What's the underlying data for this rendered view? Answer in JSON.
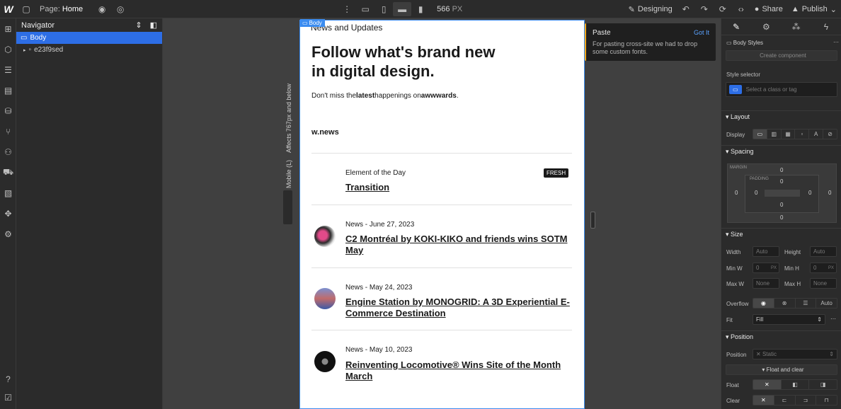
{
  "topbar": {
    "logo": "W",
    "page_prefix": "Page:",
    "page_name": "Home",
    "width_value": "566",
    "width_unit": "PX",
    "designing_label": "Designing",
    "share_label": "Share",
    "publish_label": "Publish"
  },
  "navigator": {
    "title": "Navigator",
    "items": [
      {
        "label": "Body"
      },
      {
        "label": "e23f9sed"
      }
    ]
  },
  "canvas": {
    "affects_label": "Affects 767px and below",
    "mobile_label": "Mobile (L)",
    "body_tag": "Body"
  },
  "page": {
    "kicker": "News and Updates",
    "title": "Follow what's brand new in digital design.",
    "sub_pre": "Don't miss the",
    "sub_bold1": "latest",
    "sub_mid": "happenings on",
    "sub_bold2": "awwwards",
    "sub_post": ".",
    "brand": "w.news",
    "fresh_badge": "FRESH",
    "items": [
      {
        "meta": "Element of the Day",
        "title": "Transition"
      },
      {
        "meta": "News - June 27, 2023",
        "title": "C2 Montréal by KOKI-KIKO and friends wins SOTM May"
      },
      {
        "meta": "News - May 24, 2023",
        "title": "Engine Station by MONOGRID: A 3D Experiential E-Commerce Destination"
      },
      {
        "meta": "News - May 10, 2023",
        "title": "Reinventing Locomotive® Wins Site of the Month March"
      }
    ]
  },
  "toast": {
    "title": "Paste",
    "button": "Got It",
    "body": "For pasting cross-site we had to drop some custom fonts."
  },
  "right": {
    "body_styles": "Body Styles",
    "create_component": "Create component",
    "style_selector": "Style selector",
    "selector_placeholder": "Select a class or tag",
    "layout": "Layout",
    "display": "Display",
    "spacing": "Spacing",
    "margin": "MARGIN",
    "padding": "PADDING",
    "zero": "0",
    "size": "Size",
    "width": "Width",
    "height": "Height",
    "min_w": "Min W",
    "min_h": "Min H",
    "max_w": "Max W",
    "max_h": "Max H",
    "auto": "Auto",
    "none": "None",
    "px": "PX",
    "overflow": "Overflow",
    "fit": "Fit",
    "fit_value": "Fill",
    "position_section": "Position",
    "position": "Position",
    "position_value": "Static",
    "float_and_clear": "Float and clear",
    "float": "Float",
    "clear": "Clear"
  }
}
